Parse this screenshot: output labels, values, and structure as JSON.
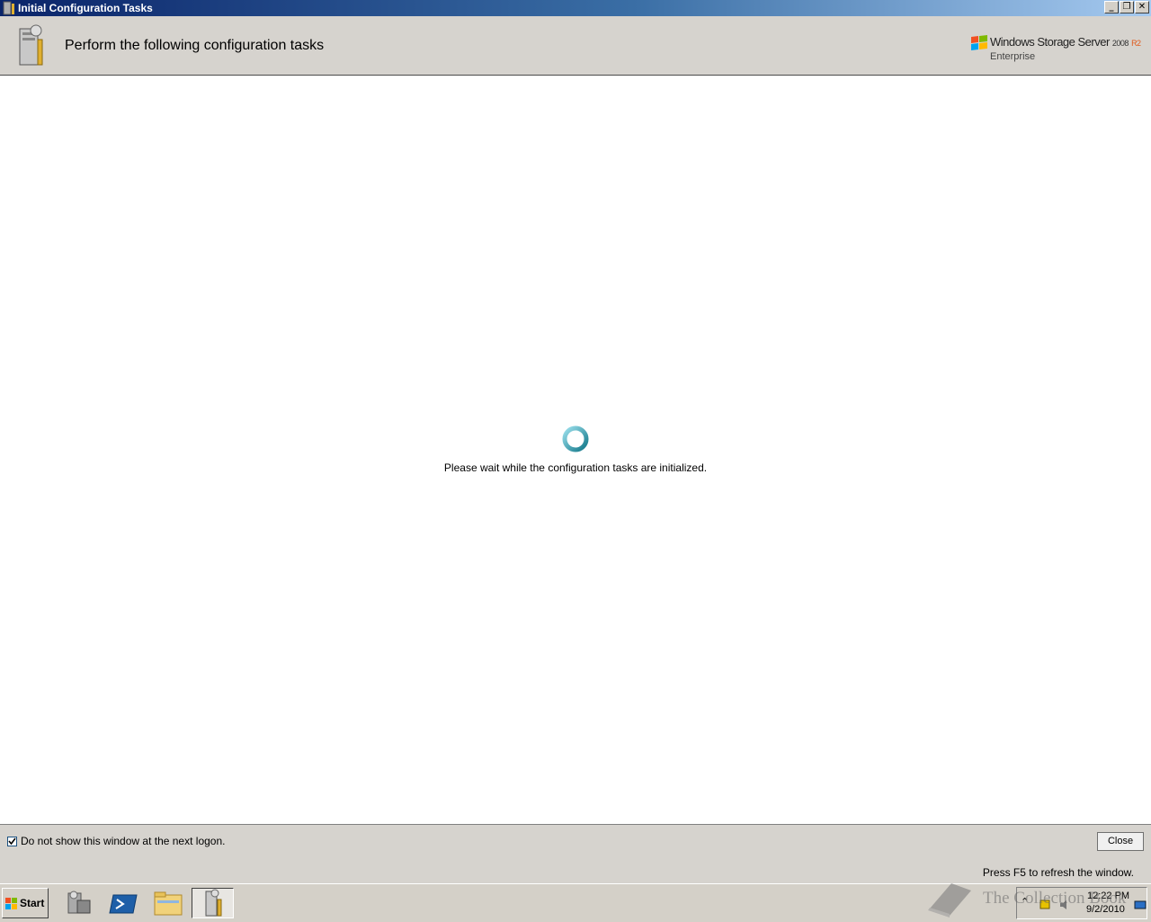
{
  "window": {
    "title": "Initial Configuration Tasks",
    "minimize_glyph": "_",
    "restore_glyph": "❐",
    "close_glyph": "✕"
  },
  "header": {
    "heading": "Perform the following configuration tasks",
    "brand": {
      "product": "Windows Storage Server",
      "version": "2008",
      "release": "R2",
      "edition": "Enterprise"
    }
  },
  "main": {
    "wait_message": "Please wait while the configuration tasks are initialized."
  },
  "footer": {
    "checkbox_label": "Do not show this window at the next logon.",
    "checkbox_checked": true,
    "close_label": "Close"
  },
  "status": {
    "hint": "Press F5 to refresh the window."
  },
  "taskbar": {
    "start_label": "Start",
    "pinned": [
      "server-manager-icon",
      "powershell-icon",
      "explorer-icon",
      "initial-configuration-tasks-icon"
    ],
    "clock_time": "12:22 PM",
    "clock_date": "9/2/2010"
  },
  "watermark": {
    "text": "The Collection Book"
  },
  "colors": {
    "titlebar_start": "#0a246a",
    "titlebar_end": "#a6caf0",
    "chrome": "#d6d3ce",
    "spinner": "#1f8ca0"
  }
}
